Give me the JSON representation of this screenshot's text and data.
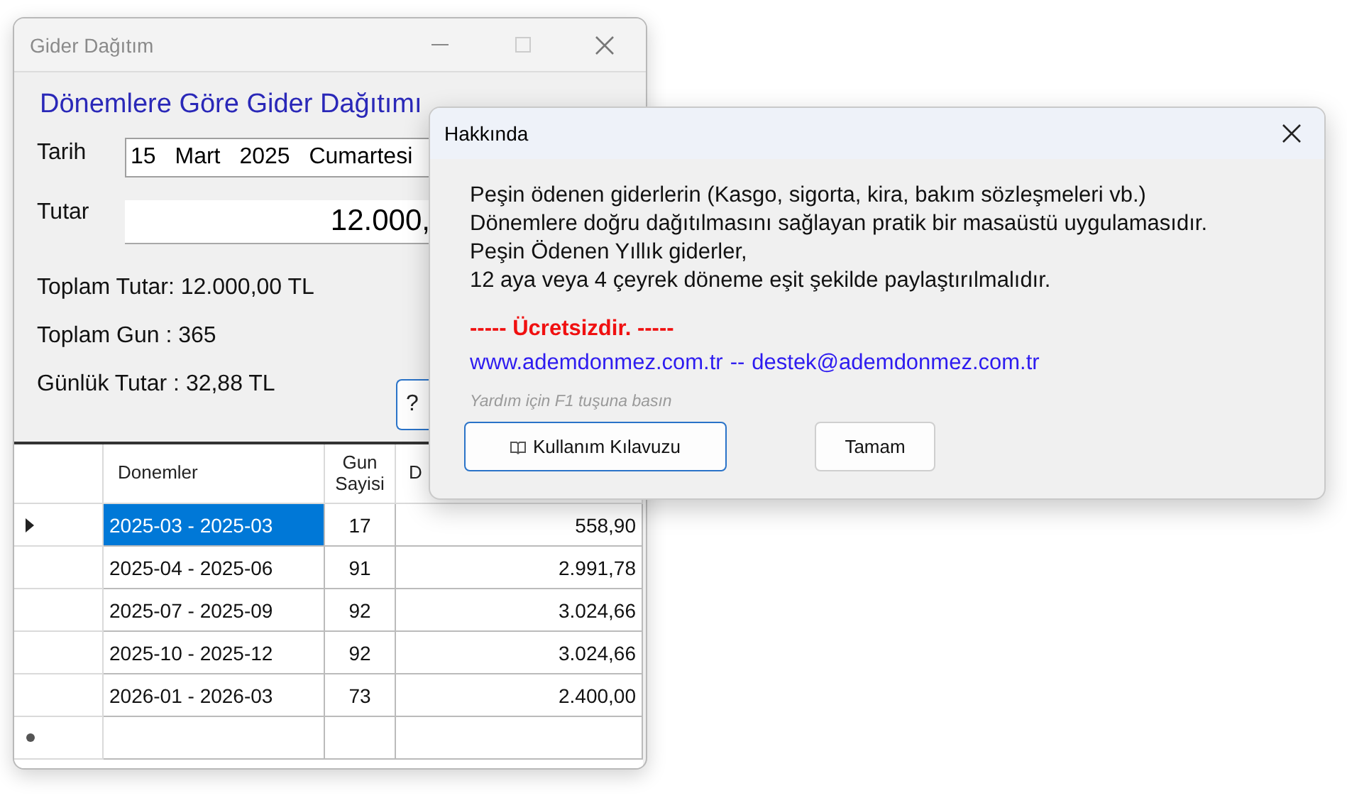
{
  "main_window": {
    "title": "Gider Dağıtım",
    "heading": "Dönemlere Göre Gider Dağıtımı",
    "date": {
      "label": "Tarih",
      "value": "15 Mart 2025 Cumartesi"
    },
    "amount": {
      "label": "Tutar",
      "value": "12.000,"
    },
    "totals": [
      "Toplam Tutar: 12.000,00 TL",
      "Toplam Gun : 365",
      "Günlük Tutar : 32,88 TL"
    ],
    "help_button": "?",
    "table": {
      "columns": [
        "Donemler",
        "Gun Sayisi",
        "D"
      ],
      "rows": [
        {
          "period": "2025-03 - 2025-03",
          "days": "17",
          "amount": "558,90",
          "selected": true
        },
        {
          "period": "2025-04 - 2025-06",
          "days": "91",
          "amount": "2.991,78",
          "selected": false
        },
        {
          "period": "2025-07 - 2025-09",
          "days": "92",
          "amount": "3.024,66",
          "selected": false
        },
        {
          "period": "2025-10 - 2025-12",
          "days": "92",
          "amount": "3.024,66",
          "selected": false
        },
        {
          "period": "2026-01 - 2026-03",
          "days": "73",
          "amount": "2.400,00",
          "selected": false
        }
      ],
      "new_row": true
    }
  },
  "about_dialog": {
    "title": "Hakkında",
    "description": [
      "Peşin ödenen giderlerin (Kasgo, sigorta, kira, bakım sözleşmeleri vb.)",
      "Dönemlere doğru dağıtılmasını sağlayan pratik bir masaüstü uygulamasıdır.",
      "Peşin Ödenen Yıllık giderler,",
      "12 aya veya 4 çeyrek döneme eşit şekilde paylaştırılmalıdır."
    ],
    "notice": "----- Ücretsizdir. -----",
    "website": "www.ademdonmez.com.tr",
    "separator": "--",
    "email": "destek@ademdonmez.com.tr",
    "hint": "Yardım için F1 tuşuna basın",
    "buttons": [
      {
        "label": "Kullanım Kılavuzu",
        "kind": "manual"
      },
      {
        "label": "Tamam",
        "kind": "ok"
      }
    ]
  }
}
